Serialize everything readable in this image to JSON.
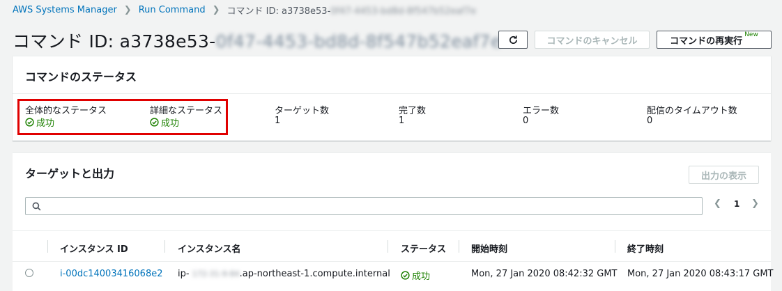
{
  "breadcrumb": {
    "items": [
      "AWS Systems Manager",
      "Run Command"
    ],
    "current_prefix": "コマンド ID: a3738e53-",
    "current_blurred": "0f47-4453-bd8d-8f547b52eaf7e"
  },
  "page": {
    "title_prefix": "コマンド ID: a3738e53-",
    "title_blurred": "0f47-4453-bd8d-8f547b52eaf7e"
  },
  "toolbar": {
    "cancel_label": "コマンドのキャンセル",
    "rerun_label": "コマンドの再実行",
    "rerun_badge": "New"
  },
  "status_panel": {
    "heading": "コマンドのステータス",
    "overall_label": "全体的なステータス",
    "overall_value": "成功",
    "detail_label": "詳細なステータス",
    "detail_value": "成功",
    "target_count_label": "ターゲット数",
    "target_count_value": "1",
    "completed_label": "完了数",
    "completed_value": "1",
    "error_label": "エラー数",
    "error_value": "0",
    "timeout_label": "配信のタイムアウト数",
    "timeout_value": "0"
  },
  "targets_panel": {
    "heading": "ターゲットと出力",
    "view_output_label": "出力の表示",
    "search_placeholder": "",
    "page_number": "1",
    "columns": [
      "インスタンス ID",
      "インスタンス名",
      "ステータス",
      "開始時刻",
      "終了時刻"
    ],
    "rows": [
      {
        "instance_id": "i-00dc14003416068e2",
        "name_prefix": "ip-",
        "name_blurred": "172-31-9-84",
        "name_suffix": ".ap-northeast-1.compute.internal",
        "status": "成功",
        "start_time": "Mon, 27 Jan 2020 08:42:32 GMT",
        "end_time": "Mon, 27 Jan 2020 08:43:17 GMT"
      }
    ]
  },
  "colors": {
    "accent": "#0073bb",
    "success": "#1d8102",
    "highlight": "#e00000"
  }
}
